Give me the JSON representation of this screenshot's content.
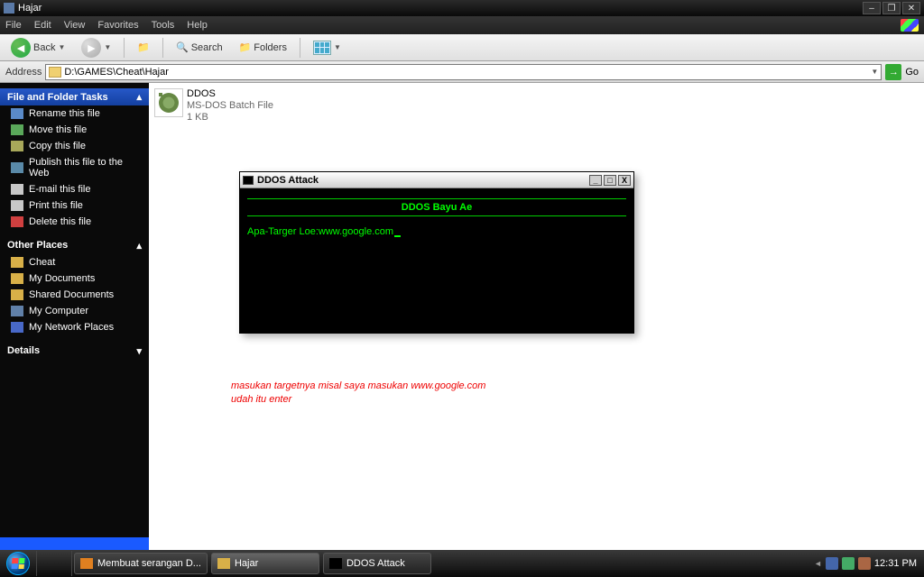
{
  "window": {
    "title": "Hajar"
  },
  "menu": [
    "File",
    "Edit",
    "View",
    "Favorites",
    "Tools",
    "Help"
  ],
  "toolbar": {
    "back": "Back",
    "search": "Search",
    "folders": "Folders"
  },
  "address": {
    "label": "Address",
    "path": "D:\\GAMES\\Cheat\\Hajar",
    "go": "Go"
  },
  "sidebar": {
    "tasks_header": "File and Folder Tasks",
    "tasks": [
      {
        "icon": "#5a8ac8",
        "label": "Rename this file"
      },
      {
        "icon": "#5aa85a",
        "label": "Move this file"
      },
      {
        "icon": "#a8a85a",
        "label": "Copy this file"
      },
      {
        "icon": "#5a8aa8",
        "label": "Publish this file to the Web"
      },
      {
        "icon": "#c8c8c8",
        "label": "E-mail this file"
      },
      {
        "icon": "#c8c8c8",
        "label": "Print this file"
      },
      {
        "icon": "#d04040",
        "label": "Delete this file"
      }
    ],
    "places_header": "Other Places",
    "places": [
      {
        "icon": "#d8b048",
        "label": "Cheat"
      },
      {
        "icon": "#d8b048",
        "label": "My Documents"
      },
      {
        "icon": "#d8b048",
        "label": "Shared Documents"
      },
      {
        "icon": "#6080a8",
        "label": "My Computer"
      },
      {
        "icon": "#4868c8",
        "label": "My Network Places"
      }
    ],
    "details_header": "Details"
  },
  "file": {
    "name": "DDOS",
    "type": "MS-DOS Batch File",
    "size": "1 KB"
  },
  "cmd": {
    "title": "DDOS Attack",
    "banner": "DDOS Bayu Ae",
    "prompt": "Apa-Targer Loe:",
    "input": "www.google.com"
  },
  "annotation": {
    "line1": "masukan targetnya misal saya masukan www.google.com",
    "line2": "udah itu enter"
  },
  "taskbar": {
    "items": [
      {
        "label": "Membuat serangan D...",
        "color": "#e08020"
      },
      {
        "label": "Hajar",
        "color": "#d8b048"
      },
      {
        "label": "DDOS Attack",
        "color": "#000"
      }
    ],
    "clock": "12:31 PM"
  }
}
